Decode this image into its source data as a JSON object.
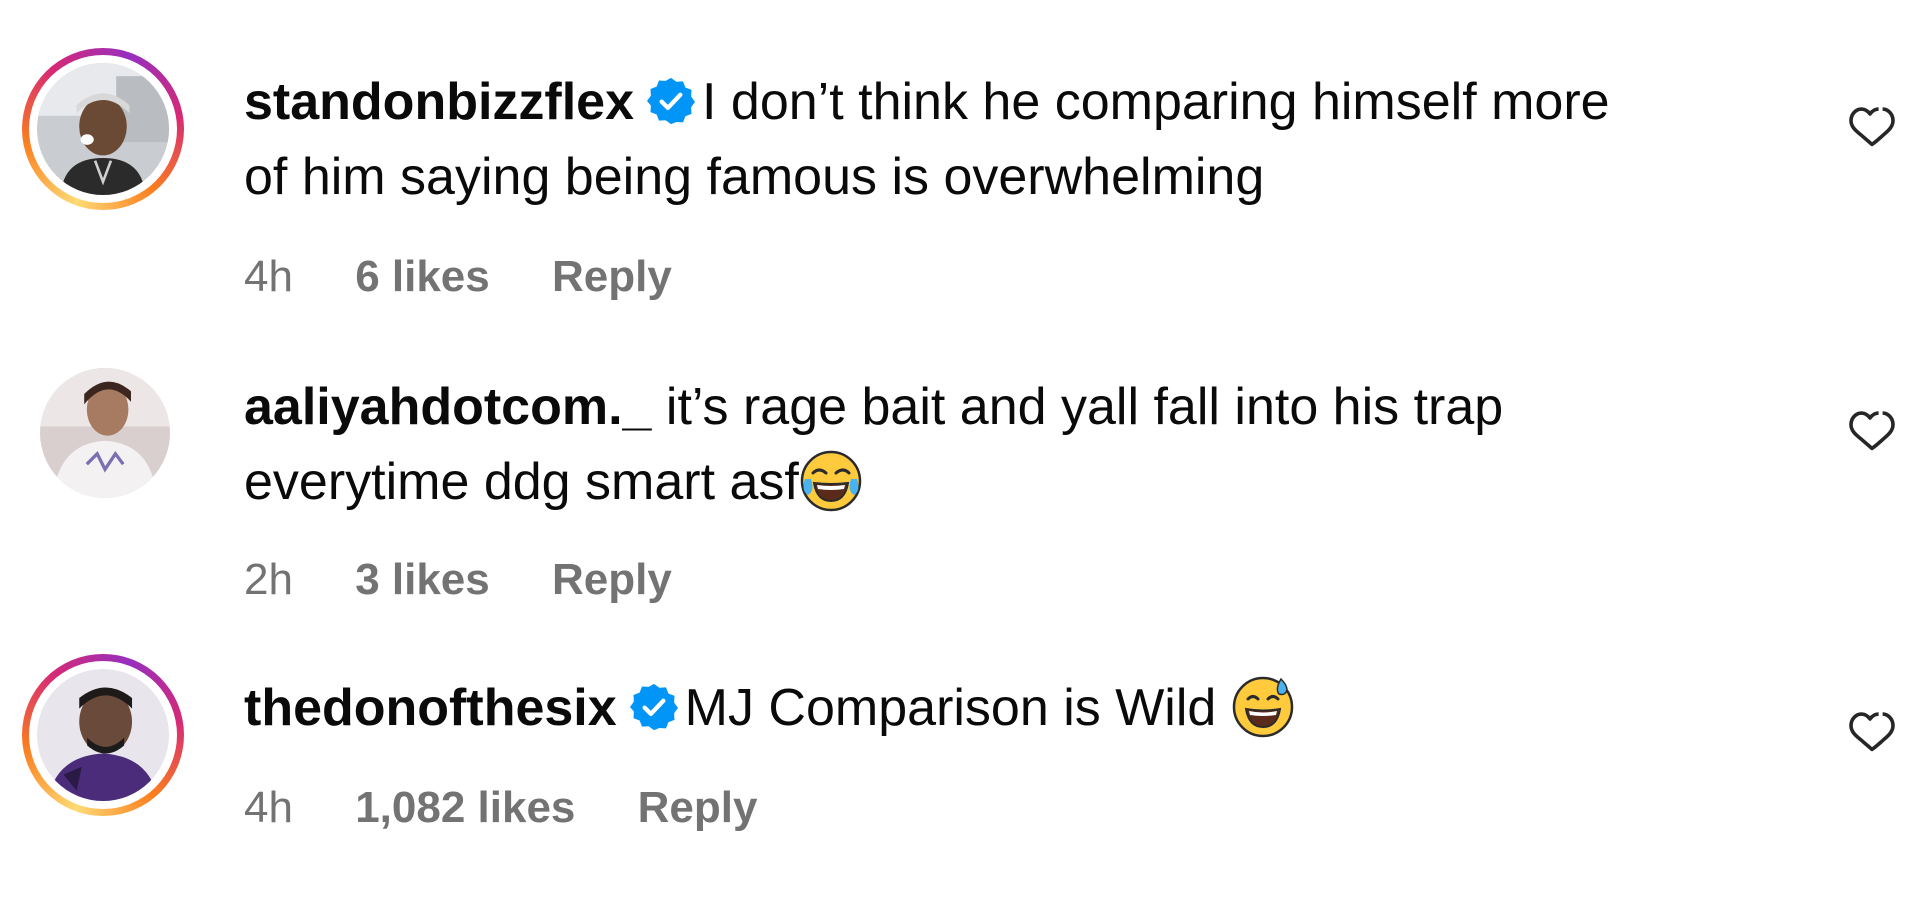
{
  "comments": [
    {
      "username": "standonbizzflex",
      "verified": true,
      "text_line1": "I don’t think he comparing himself more",
      "text_line2": "of him saying being famous is overwhelming",
      "time": "4h",
      "likes": "6 likes",
      "reply_label": "Reply",
      "avatar_ring": "story"
    },
    {
      "username": "aaliyahdotcom._",
      "verified": false,
      "text_line1": "it’s rage bait and yall fall into his trap",
      "text_line2": "everytime ddg smart asf",
      "emoji": "face-with-tears-of-joy",
      "time": "2h",
      "likes": "3 likes",
      "reply_label": "Reply",
      "avatar_ring": "none"
    },
    {
      "username": "thedonofthesix",
      "verified": true,
      "text_line1": "MJ Comparison is Wild",
      "emoji": "grinning-face-with-sweat",
      "time": "4h",
      "likes": "1,082 likes",
      "reply_label": "Reply",
      "avatar_ring": "story"
    }
  ],
  "colors": {
    "text": "#0a0a0a",
    "meta": "#737373",
    "verified_badge": "#0095f6",
    "story_ring": [
      "#feda75",
      "#fa7e1e",
      "#d62976",
      "#962fbf"
    ]
  },
  "icons": {
    "verified": "verified-badge-icon",
    "like": "heart-outline-icon"
  }
}
